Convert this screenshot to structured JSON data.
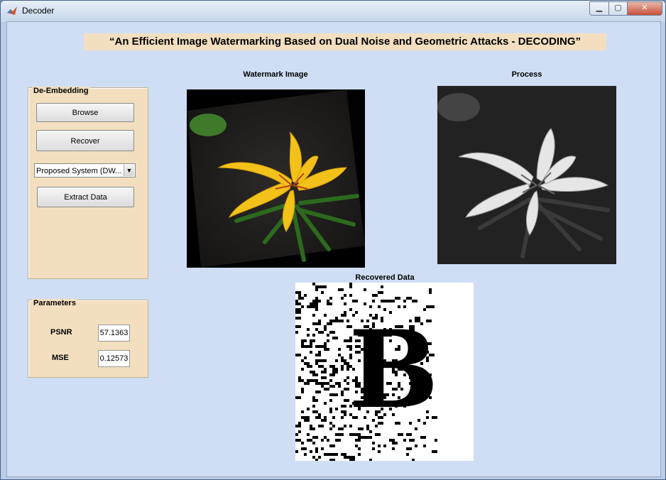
{
  "window": {
    "title": "Decoder",
    "icon": "matlab-icon",
    "controls": {
      "minimize": "minimize-icon",
      "maximize": "maximize-icon",
      "close": "close-icon"
    }
  },
  "heading": "“An Efficient Image Watermarking Based on Dual Noise and Geometric Attacks - DECODING”",
  "de_embedding": {
    "title": "De-Embedding",
    "browse_label": "Browse",
    "recover_label": "Recover",
    "method_selected": "Proposed System (DW...",
    "extract_label": "Extract Data"
  },
  "parameters": {
    "title": "Parameters",
    "psnr_label": "PSNR",
    "psnr_value": "57.1363",
    "mse_label": "MSE",
    "mse_value": "0.12573"
  },
  "images": {
    "watermark_title": "Watermark Image",
    "process_title": "Process",
    "recovered_title": "Recovered Data"
  },
  "colors": {
    "panel": "#f3dfc0",
    "background": "#cfdef5",
    "lily_yellow": "#f2c21a"
  }
}
